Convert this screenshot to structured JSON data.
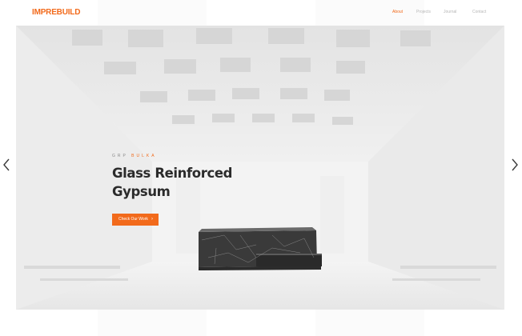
{
  "brand": {
    "logo_text": "IMPREBUILD",
    "accent_color": "#f26a1b"
  },
  "nav": {
    "items": [
      {
        "label": "About",
        "active": true
      },
      {
        "label": "Projects",
        "active": false
      },
      {
        "label": "Journal",
        "active": false
      },
      {
        "label": "Contact",
        "active": false
      }
    ]
  },
  "hero": {
    "kicker_prefix": "GRP",
    "kicker_accent": "BULKA",
    "title_line1": "Glass Reinforced",
    "title_line2": "Gypsum",
    "cta_label": "Check Our Work",
    "cta_arrow": "›",
    "prev_icon": "chevron-left-icon",
    "next_icon": "chevron-right-icon"
  }
}
